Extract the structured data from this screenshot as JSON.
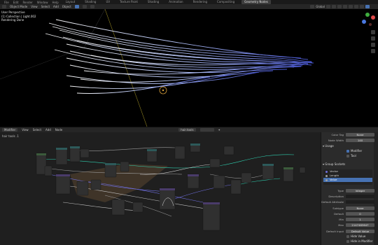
{
  "topbar": {
    "menus": [
      "File",
      "Edit",
      "Render",
      "Window",
      "Help"
    ],
    "workspaces": [
      "Layout",
      "Shading",
      "UV",
      "Texture Paint",
      "Shading",
      "Animation",
      "Rendering",
      "Compositing",
      "Geometry Nodes"
    ],
    "active_workspace": "Geometry Nodes"
  },
  "viewport": {
    "header": {
      "mode": "Object Mode",
      "menus": [
        "View",
        "Select",
        "Add",
        "Object"
      ],
      "transform": "Global"
    },
    "info": {
      "line1": "User Perspective",
      "line2": "(1) Collection | Light.002",
      "line3": "Rendering Done"
    },
    "colors": {
      "hair": "#b8c8ff",
      "hair_shade": "#4c5bd8",
      "light": "#d9a03a",
      "axis": "#8a7d20"
    }
  },
  "node_editor": {
    "header": {
      "editor": "Modifier",
      "menus": [
        "View",
        "Select",
        "Add",
        "Node"
      ],
      "tree": "hair.tools"
    },
    "breadcrumb": "hair tools .1"
  },
  "sidebar": {
    "fields": [
      {
        "label": "Color Tag",
        "value": "None"
      },
      {
        "label": "Node Width",
        "value": "140"
      }
    ],
    "usage_title": "Usage",
    "usage_modifier": "Modifier",
    "usage_tool": "Tool",
    "group_sockets_title": "Group Sockets",
    "sockets": [
      {
        "name": "Vector",
        "color": "#6f6fe0"
      },
      {
        "name": "Length",
        "color": "#a1a1a1"
      },
      {
        "name": "Value",
        "color": "#a1a1a1"
      }
    ],
    "props": [
      {
        "label": "Type",
        "value": "Integer"
      },
      {
        "label": "Description",
        "value": ""
      },
      {
        "label": "Default Attribute",
        "value": ""
      },
      {
        "label": "Subtype",
        "value": "None"
      },
      {
        "label": "Default",
        "value": "0"
      },
      {
        "label": "Min",
        "value": "1"
      },
      {
        "label": "Max",
        "value": "2147483647"
      },
      {
        "label": "Default Input",
        "value": "Default Value"
      }
    ],
    "hide_value": "Hide Value",
    "hide_in_modifier": "Hide in Modifier"
  }
}
